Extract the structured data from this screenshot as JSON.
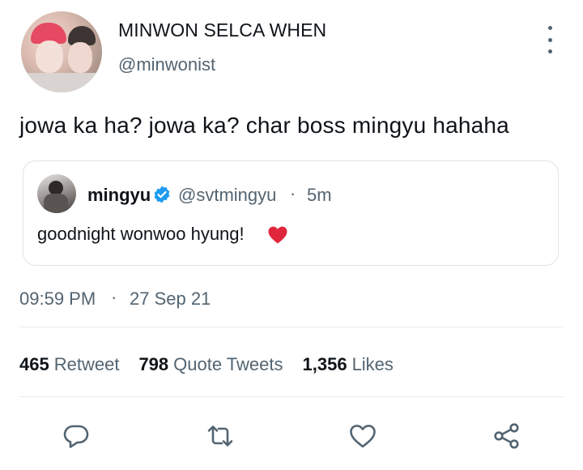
{
  "author": {
    "display_name": "MINWON SELCA WHEN",
    "handle": "@minwonist"
  },
  "tweet": {
    "text": "jowa ka ha? jowa ka? char boss mingyu hahaha"
  },
  "quoted_tweet": {
    "name": "mingyu",
    "verified": true,
    "handle": "@svtmingyu",
    "separator": "·",
    "time_ago": "5m",
    "text": "goodnight wonwoo hyung!",
    "emoji": "red-heart"
  },
  "timestamp": {
    "time": "09:59 PM",
    "separator": "·",
    "date": "27 Sep 21"
  },
  "stats": [
    {
      "count": "465",
      "label": "Retweet"
    },
    {
      "count": "798",
      "label": "Quote Tweets"
    },
    {
      "count": "1,356",
      "label": "Likes"
    }
  ],
  "actions": [
    {
      "icon": "reply-icon"
    },
    {
      "icon": "retweet-icon"
    },
    {
      "icon": "like-icon"
    },
    {
      "icon": "share-icon"
    }
  ],
  "colors": {
    "primary_text": "#0f1419",
    "secondary_text": "#536471",
    "verified_blue": "#1d9bf0",
    "heart_red": "#e0263b",
    "border": "#dfe4e8"
  }
}
